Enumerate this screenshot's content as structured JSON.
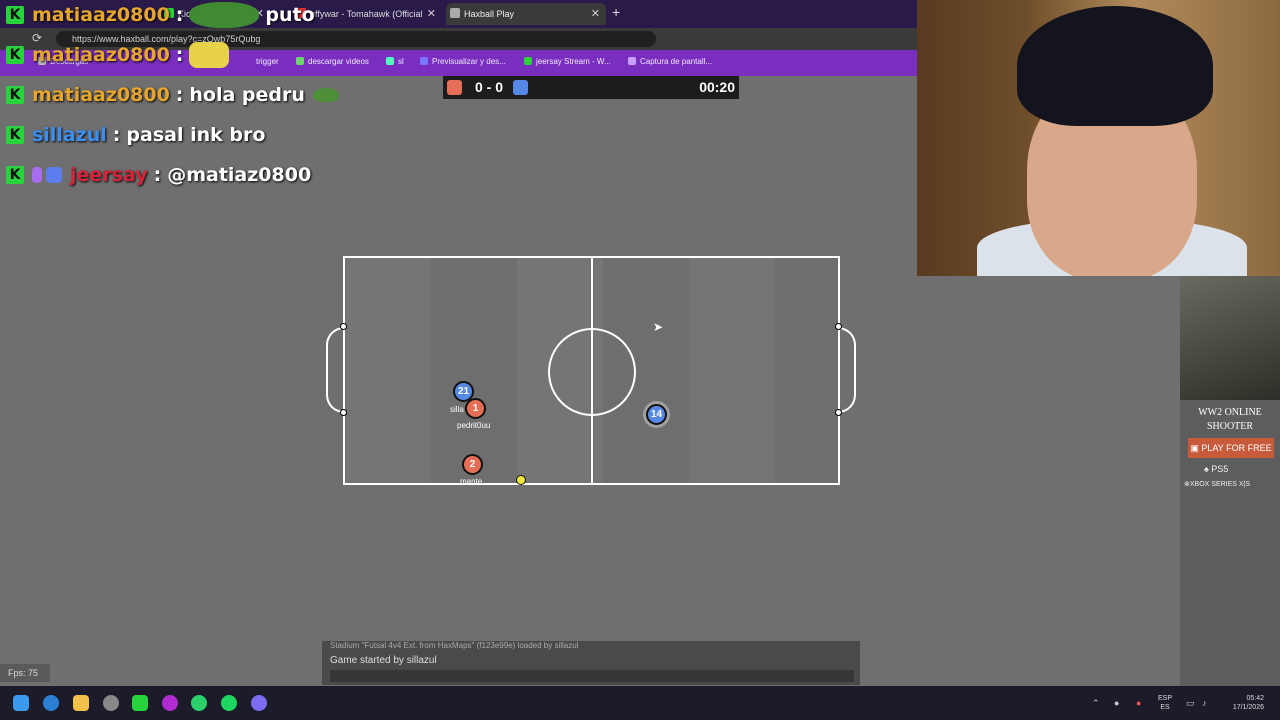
{
  "browser": {
    "tabs": [
      {
        "label": "Kick D",
        "active": false
      },
      {
        "label": "effywar - Tomahawk (Official",
        "active": false
      },
      {
        "label": "Haxball Play",
        "active": true
      }
    ],
    "url": "https://www.haxball.com/play?c=zOwb75rQubg",
    "bookmarks": [
      "Descargas",
      "trigger",
      "descargar videos",
      "sl",
      "Previsualizar y des...",
      "jeersay Stream - W...",
      "Captura de pantall..."
    ]
  },
  "chat_overlay": [
    {
      "user": "matiaaz0800",
      "sep": ":",
      "message": "puto",
      "user_color": "#e6a52d"
    },
    {
      "user": "matiaaz0800",
      "sep": ":",
      "message": "",
      "user_color": "#e6a52d"
    },
    {
      "user": "matiaaz0800",
      "sep": ":",
      "message": "hola pedru",
      "user_color": "#e6a52d"
    },
    {
      "user": "sillazul",
      "sep": ":",
      "message": "pasal ink bro",
      "user_color": "#3c8ff0"
    },
    {
      "user": "jeersay",
      "sep": ":",
      "message": "@matiaz0800",
      "user_color": "#d4243a"
    }
  ],
  "scoreboard": {
    "score": "0 - 0",
    "time": "00:20",
    "red_color": "#e56e56",
    "blue_color": "#5689e5"
  },
  "players": [
    {
      "number": "21",
      "team": "blue",
      "name": "silla"
    },
    {
      "number": "1",
      "team": "red",
      "name": "pedrit0uu"
    },
    {
      "number": "2",
      "team": "red",
      "name": "mante"
    },
    {
      "number": "14",
      "team": "blue",
      "name": ""
    }
  ],
  "game_chat": {
    "previous": "Stadium \"Futsal 4v4 Ext. from HaxMaps\" (f123e99e) loaded by sillazul",
    "message": "Game started by sillazul"
  },
  "fps": "Fps: 75",
  "ad": {
    "title_line1": "WW2 ONLINE",
    "title_line2": "SHOOTER",
    "button": "PLAY FOR FREE",
    "platform1": "PS5",
    "platform2": "XBOX SERIES X|S"
  },
  "taskbar": {
    "lang_line1": "ESP",
    "lang_line2": "ES",
    "time": "05:42",
    "date": "17/1/2026"
  }
}
